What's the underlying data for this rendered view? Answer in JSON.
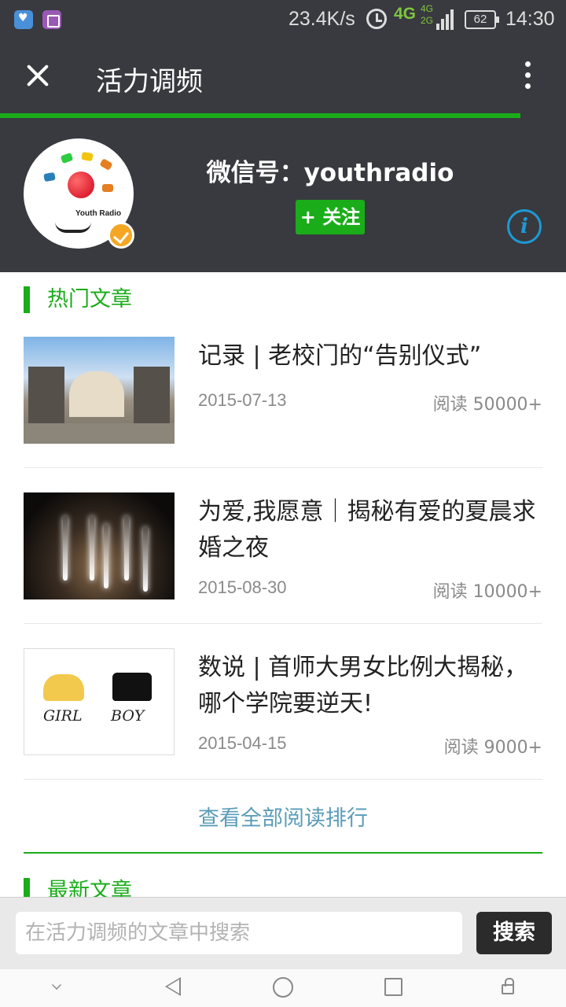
{
  "status_bar": {
    "network_speed": "23.4K/s",
    "network_type": "4G",
    "network_type_small_top": "4G",
    "network_type_small_bottom": "2G",
    "battery": "62",
    "time": "14:30",
    "icons": [
      "app-icon-heart",
      "app-icon-gallery",
      "alarm-icon",
      "signal-icon",
      "battery-icon"
    ]
  },
  "title_bar": {
    "title": "活力调频",
    "close_icon": "close-icon",
    "more_icon": "more-vertical-icon",
    "load_progress": 0.92,
    "progress_color": "#1aad19"
  },
  "profile": {
    "logo_text": "Youth Radio",
    "wechat_id": "微信号：youthradio",
    "follow_label": "+ 关注",
    "info_icon": "info-icon",
    "accent": "#1aad19"
  },
  "hot_section": {
    "heading": "热门文章",
    "articles": [
      {
        "title": "记录 | 老校门的“告别仪式”",
        "date": "2015-07-13",
        "reads": "阅读 50000+"
      },
      {
        "title": "为爱,我愿意｜揭秘有爱的夏晨求婚之夜",
        "date": "2015-08-30",
        "reads": "阅读 10000+"
      },
      {
        "title": "数说 | 首师大男女比例大揭秘，哪个学院要逆天!",
        "date": "2015-04-15",
        "reads": "阅读 9000+"
      }
    ],
    "view_all": "查看全部阅读排行"
  },
  "latest_section": {
    "heading": "最新文章"
  },
  "thumbnail_labels": {
    "girl": "GIRL",
    "boy": "BOY"
  },
  "search": {
    "placeholder": "在活力调频的文章中搜索",
    "value": "",
    "button": "搜索"
  },
  "nav_bar": {
    "icons": [
      "collapse-chevron-icon",
      "back-icon",
      "home-icon",
      "recent-apps-icon",
      "lock-icon"
    ]
  }
}
